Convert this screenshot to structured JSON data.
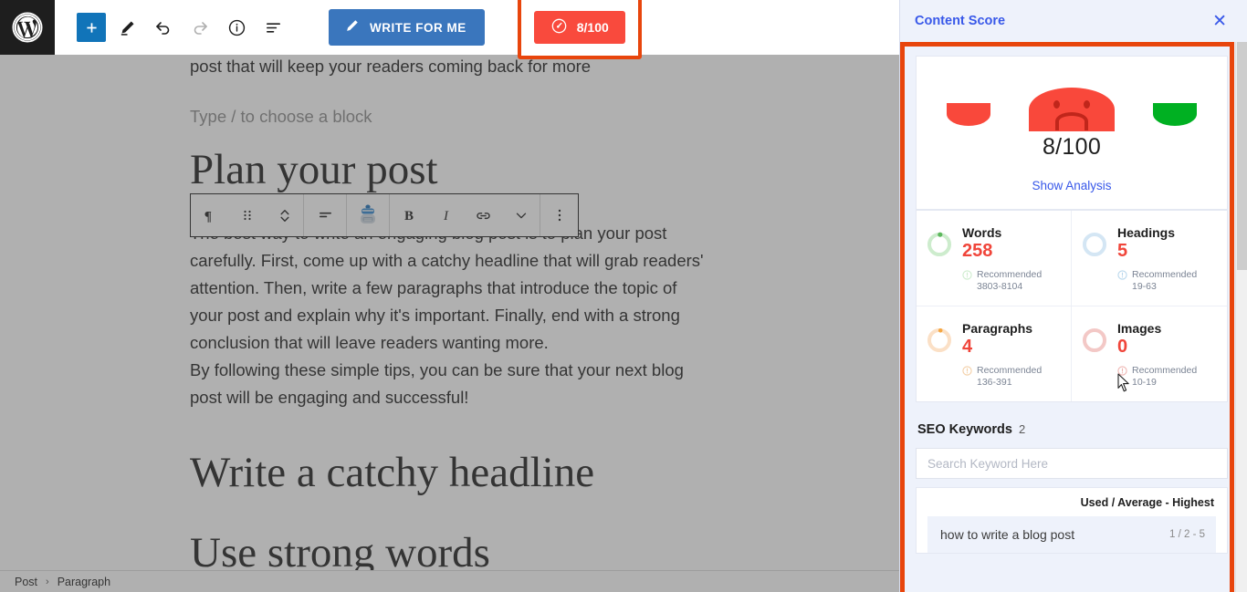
{
  "topbar": {
    "logo_icon": "wordpress-logo",
    "add_block_label": "+",
    "tools": [
      {
        "name": "add-block-button",
        "icon": "plus-icon",
        "label": "+"
      },
      {
        "name": "edit-tool-button",
        "icon": "pencil-icon"
      },
      {
        "name": "undo-button",
        "icon": "undo-arrow-icon"
      },
      {
        "name": "redo-button",
        "icon": "redo-arrow-icon"
      },
      {
        "name": "details-button",
        "icon": "info-circle-icon"
      },
      {
        "name": "list-view-button",
        "icon": "list-view-icon"
      }
    ],
    "write_for_me_label": "WRITE FOR ME",
    "write_for_me_icon": "pencil-icon",
    "score_badge_label": "8/100",
    "score_badge_icon": "speedometer-icon"
  },
  "editor": {
    "paragraph_clipped": "comment. By following these steps, you can write an engaging blog post that will keep your readers coming back for more",
    "placeholder": "Type / to choose a block",
    "heading_hidden": "Plan your post",
    "paragraph_1": "The best way to write an engaging blog post is to plan your post carefully. First, come up with a catchy headline that will grab readers' attention. Then, write a few paragraphs that introduce the topic of your post and explain why it's important. Finally, end with a strong conclusion that will leave readers wanting more.",
    "paragraph_2": "By following these simple tips, you can be sure that your next blog post will be engaging and successful!",
    "heading_1": "Write a catchy headline",
    "heading_2": "Use strong words",
    "block_toolbar": [
      {
        "name": "block-type-paragraph-button",
        "icon": "paragraph-icon"
      },
      {
        "name": "drag-handle-button",
        "icon": "drag-dots-icon"
      },
      {
        "name": "move-updown-button",
        "icon": "chevron-updown-icon"
      },
      {
        "name": "align-button",
        "icon": "align-left-icon"
      },
      {
        "name": "ai-assistant-button",
        "icon": "robot-icon"
      },
      {
        "name": "bold-button",
        "icon": "bold-icon",
        "label": "B"
      },
      {
        "name": "italic-button",
        "icon": "italic-icon",
        "label": "I"
      },
      {
        "name": "link-button",
        "icon": "link-icon"
      },
      {
        "name": "more-rich-text-button",
        "icon": "chevron-down-icon"
      },
      {
        "name": "block-options-button",
        "icon": "vertical-dots-icon"
      }
    ]
  },
  "breadcrumb": {
    "items": [
      "Post",
      "Paragraph"
    ],
    "separator": "›"
  },
  "sidebar": {
    "title": "Content Score",
    "close_icon": "close-icon",
    "gauge": {
      "score": "8/100",
      "show_analysis_label": "Show Analysis",
      "face_icon": "sad-face-icon",
      "bad_color": "#f9483b",
      "good_color": "#00b022"
    },
    "metrics": [
      {
        "label": "Words",
        "value": "258",
        "recommended_label": "Recommended",
        "recommended_range": "3803-8104",
        "ring_color": "#cdeccd",
        "dot_color": "#5cb85c"
      },
      {
        "label": "Headings",
        "value": "5",
        "recommended_label": "Recommended",
        "recommended_range": "19-63",
        "ring_color": "#d4e6f4",
        "dot_color": "#d4e6f4"
      },
      {
        "label": "Paragraphs",
        "value": "4",
        "recommended_label": "Recommended",
        "recommended_range": "136-391",
        "ring_color": "#fbe0c6",
        "dot_color": "#f5a742"
      },
      {
        "label": "Images",
        "value": "0",
        "recommended_label": "Recommended",
        "recommended_range": "10-19",
        "ring_color": "#f3c8c6",
        "dot_color": "#f3c8c6"
      }
    ],
    "seo": {
      "title": "SEO Keywords",
      "count": "2",
      "search_placeholder": "Search Keyword Here",
      "table_header": "Used / Average - Highest",
      "rows": [
        {
          "keyword": "how to write a blog post",
          "stat": "1 / 2 - 5"
        }
      ]
    }
  }
}
